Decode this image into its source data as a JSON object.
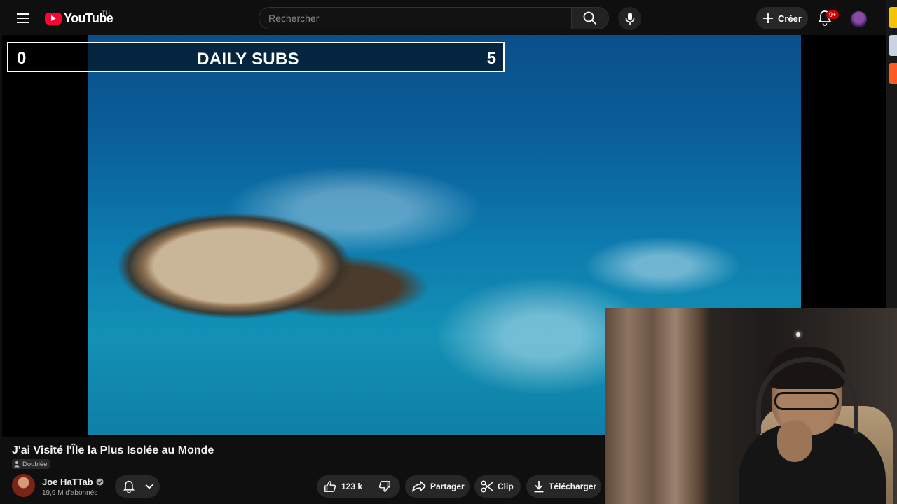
{
  "header": {
    "logo_text": "YouTube",
    "country_code": "TH",
    "search_placeholder": "Rechercher",
    "create_label": "Créer",
    "notifications_badge": "9+"
  },
  "overlay": {
    "left_value": "0",
    "title": "DAILY SUBS",
    "right_value": "5"
  },
  "video": {
    "title": "J'ai Visité l'Île la Plus Isolée au Monde",
    "dubbed_label": "Doublée"
  },
  "channel": {
    "name": "Joe HaTTab",
    "subscribers": "19,9 M d'abonnés"
  },
  "actions": {
    "likes": "123 k",
    "share_label": "Partager",
    "clip_label": "Clip",
    "download_label": "Télécharger"
  },
  "colors": {
    "brand_red": "#ff0033",
    "background": "#0f0f0f",
    "pill_bg": "#272727"
  }
}
